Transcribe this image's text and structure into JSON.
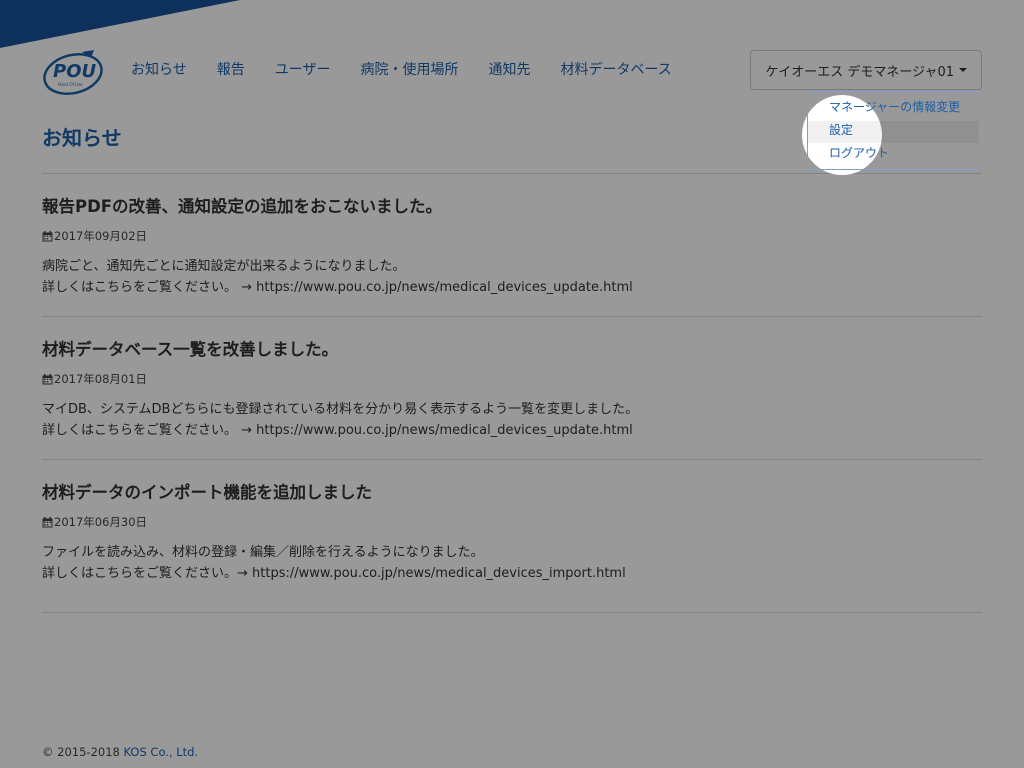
{
  "brand": {
    "logo_text": "POU",
    "logo_subtext": "Point Of Use"
  },
  "nav": {
    "items": [
      {
        "label": "お知らせ"
      },
      {
        "label": "報告"
      },
      {
        "label": "ユーザー"
      },
      {
        "label": "病院・使用場所"
      },
      {
        "label": "通知先"
      },
      {
        "label": "材料データベース"
      }
    ]
  },
  "user_menu": {
    "label": "ケイオーエス デモマネージャ01",
    "items": [
      {
        "label": "マネージャーの情報変更"
      },
      {
        "label": "設定"
      },
      {
        "label": "ログアウト"
      }
    ]
  },
  "page": {
    "title": "お知らせ"
  },
  "news": [
    {
      "title": "報告PDFの改善、通知設定の追加をおこないました。",
      "date": "2017年09月02日",
      "line1": "病院ごと、通知先ごとに通知設定が出来るようになりました。",
      "line2": "詳しくはこちらをご覧ください。 → https://www.pou.co.jp/news/medical_devices_update.html"
    },
    {
      "title": "材料データベース一覧を改善しました。",
      "date": "2017年08月01日",
      "line1": "マイDB、システムDBどちらにも登録されている材料を分かり易く表示するよう一覧を変更しました。",
      "line2": "詳しくはこちらをご覧ください。 → https://www.pou.co.jp/news/medical_devices_update.html"
    },
    {
      "title": "材料データのインポート機能を追加しました",
      "date": "2017年06月30日",
      "line1": "ファイルを読み込み、材料の登録・編集／削除を行えるようになりました。",
      "line2": "詳しくはこちらをご覧ください。→ https://www.pou.co.jp/news/medical_devices_import.html"
    }
  ],
  "footer": {
    "copyright": "© 2015-2018 ",
    "company": "KOS Co., Ltd."
  },
  "colors": {
    "accent": "#1d5fa8",
    "ribbon": "#17519a",
    "overlay": "rgba(0,0,0,0.40)"
  }
}
